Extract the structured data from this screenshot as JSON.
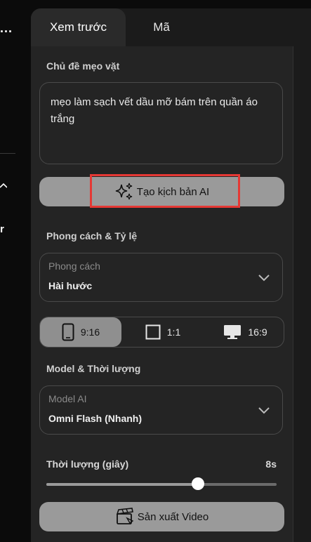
{
  "left_sidebar": {
    "dots": "...",
    "partial_label": "r"
  },
  "tabs": {
    "preview": "Xem trước",
    "code": "Mã"
  },
  "topic": {
    "label": "Chủ đề mẹo vặt",
    "value": "mẹo làm sạch vết dầu mỡ bám trên quần áo trắng"
  },
  "generate_button": {
    "label": "Tạo kịch bản AI",
    "icon": "sparkle-icon"
  },
  "style_section": {
    "label": "Phong cách & Tỷ lệ",
    "style_select": {
      "label": "Phong cách",
      "value": "Hài hước"
    },
    "ratios": [
      {
        "label": "9:16",
        "icon": "phone-icon",
        "selected": true
      },
      {
        "label": "1:1",
        "icon": "square-icon",
        "selected": false
      },
      {
        "label": "16:9",
        "icon": "monitor-icon",
        "selected": false
      }
    ]
  },
  "model_section": {
    "label": "Model & Thời lượng",
    "model_select": {
      "label": "Model AI",
      "value": "Omni Flash (Nhanh)"
    }
  },
  "duration": {
    "label": "Thời lượng (giây)",
    "value": "8s",
    "fraction": 0.66
  },
  "produce_button": {
    "label": "Sản xuất Video",
    "icon": "clapperboard-icon"
  },
  "colors": {
    "highlight": "#e53935",
    "button_bg": "#9a9a9a",
    "panel_bg": "#242424"
  }
}
